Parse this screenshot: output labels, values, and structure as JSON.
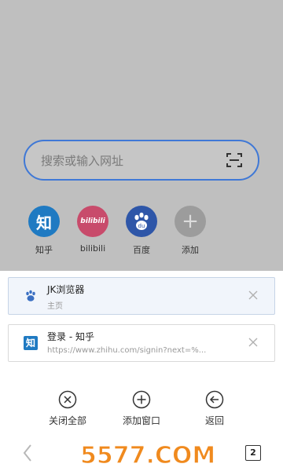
{
  "search": {
    "placeholder": "搜索或输入网址"
  },
  "shortcuts": [
    {
      "label": "知乎",
      "icon": "zhihu-logo",
      "color": "#1f7ac2",
      "glyph": "知"
    },
    {
      "label": "bilibili",
      "icon": "bilibili-logo",
      "color": "#c84b6b",
      "glyph": "bilibili"
    },
    {
      "label": "百度",
      "icon": "baidu-paw-logo",
      "color": "#2e56a8",
      "glyph": "du"
    },
    {
      "label": "添加",
      "icon": "add-icon",
      "color": "#9c9c9c",
      "glyph": "+"
    }
  ],
  "tabs": [
    {
      "title": "JK浏览器",
      "subtitle": "主页",
      "icon": "paw-icon",
      "active": true
    },
    {
      "title": "登录 - 知乎",
      "subtitle": "https://www.zhihu.com/signin?next=%...",
      "icon": "zhihu-icon",
      "active": false
    }
  ],
  "actions": {
    "close_all": "关闭全部",
    "new_window": "添加窗口",
    "back": "返回"
  },
  "bottom_bar": {
    "tab_count": "2"
  },
  "watermark": "5577.COM"
}
